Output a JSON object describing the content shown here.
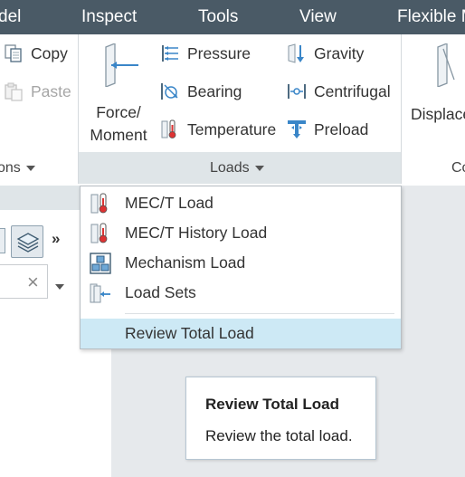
{
  "menubar": {
    "items": [
      "del",
      "Inspect",
      "Tools",
      "View",
      "Flexible M"
    ]
  },
  "ribbon": {
    "clipboard": {
      "copy_label": "Copy",
      "paste_label": "Paste",
      "group_label": "ons"
    },
    "loads": {
      "force_moment_line1": "Force/",
      "force_moment_line2": "Moment",
      "pressure_label": "Pressure",
      "bearing_label": "Bearing",
      "temperature_label": "Temperature",
      "gravity_label": "Gravity",
      "centrifugal_label": "Centrifugal",
      "preload_label": "Preload",
      "group_label": "Loads"
    },
    "next": {
      "displace_label": "Displace",
      "group_label": "Co"
    }
  },
  "left_panel": {
    "overflow_label": "»",
    "clear_glyph": "×"
  },
  "dropdown": {
    "items": [
      {
        "label": "MEC/T Load",
        "icon": "thermometer-icon"
      },
      {
        "label": "MEC/T History Load",
        "icon": "thermometer-icon"
      },
      {
        "label": "Mechanism Load",
        "icon": "mechanism-icon"
      },
      {
        "label": "Load Sets",
        "icon": "load-sets-icon"
      }
    ],
    "highlighted": {
      "label": "Review Total Load"
    }
  },
  "tooltip": {
    "title": "Review Total Load",
    "body": "Review the total load."
  },
  "colors": {
    "menubar_bg": "#4a5a66",
    "hover_bg": "#cde9f5",
    "group_footer_active": "#dfe5e8",
    "workspace_bg": "#e6e9ec"
  }
}
